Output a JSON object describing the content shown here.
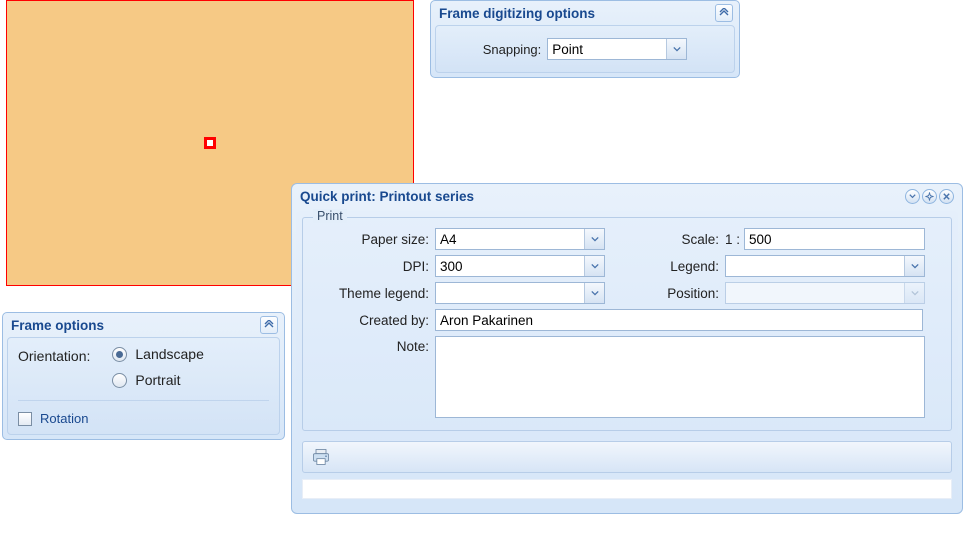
{
  "preview": {
    "marker": "center"
  },
  "digitizing": {
    "title": "Frame digitizing options",
    "snapping_label": "Snapping:",
    "snapping_value": "Point"
  },
  "frame_options": {
    "title": "Frame options",
    "orientation_label": "Orientation:",
    "landscape_label": "Landscape",
    "portrait_label": "Portrait",
    "orientation_value": "Landscape",
    "rotation_label": "Rotation",
    "rotation_checked": false
  },
  "quickprint": {
    "title": "Quick print: Printout series",
    "fieldset_legend": "Print",
    "labels": {
      "paper_size": "Paper size:",
      "dpi": "DPI:",
      "theme_legend": "Theme legend:",
      "created_by": "Created by:",
      "note": "Note:",
      "scale": "Scale:",
      "legend": "Legend:",
      "position": "Position:"
    },
    "values": {
      "paper_size": "A4",
      "dpi": "300",
      "theme_legend": "",
      "scale_prefix": "1 :",
      "scale": "500",
      "legend": "",
      "position": "",
      "created_by": "Aron Pakarinen",
      "note": ""
    },
    "toolbar": {
      "print_icon": "printer"
    }
  }
}
